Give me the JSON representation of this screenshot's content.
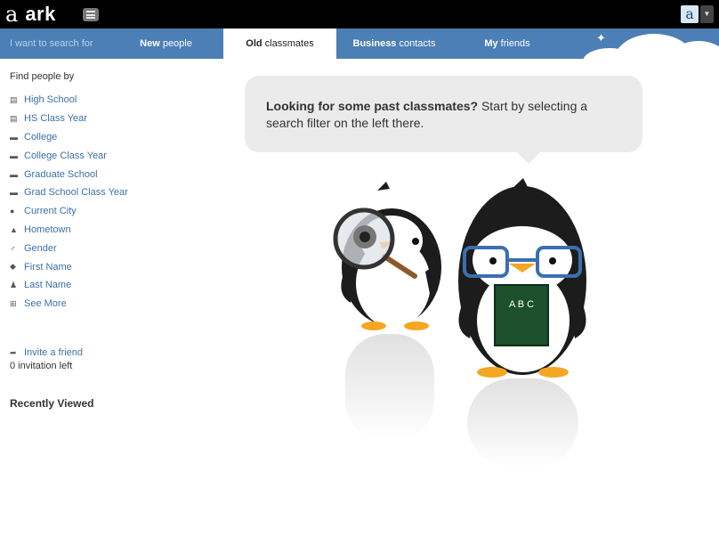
{
  "app": {
    "logo_mark": "a",
    "logo_text": "ark",
    "account_initial": "a",
    "account_caret": "▼"
  },
  "nav": {
    "search_prompt": "I want to search for",
    "tabs": [
      {
        "bold": "New",
        "rest": " people",
        "active": false
      },
      {
        "bold": "Old",
        "rest": " classmates",
        "active": true
      },
      {
        "bold": "Business",
        "rest": " contacts",
        "active": false
      },
      {
        "bold": "My",
        "rest": " friends",
        "active": false
      }
    ]
  },
  "sidebar": {
    "find_title": "Find people by",
    "filters": [
      {
        "icon": "school-icon",
        "glyph": "▤",
        "label": "High School"
      },
      {
        "icon": "school-icon",
        "glyph": "▤",
        "label": "HS Class Year"
      },
      {
        "icon": "graduation-cap-icon",
        "glyph": "▬",
        "label": "College"
      },
      {
        "icon": "graduation-cap-icon",
        "glyph": "▬",
        "label": "College Class Year"
      },
      {
        "icon": "graduation-cap-icon",
        "glyph": "▬",
        "label": "Graduate School"
      },
      {
        "icon": "graduation-cap-icon",
        "glyph": "▬",
        "label": "Grad School Class Year"
      },
      {
        "icon": "location-pin-icon",
        "glyph": "●",
        "label": "Current City"
      },
      {
        "icon": "home-icon",
        "glyph": "▲",
        "label": "Hometown"
      },
      {
        "icon": "gender-icon",
        "glyph": "♂",
        "label": "Gender"
      },
      {
        "icon": "tag-icon",
        "glyph": "◆",
        "label": "First Name"
      },
      {
        "icon": "person-icon",
        "glyph": "♟",
        "label": "Last Name"
      },
      {
        "icon": "plus-box-icon",
        "glyph": "⊞",
        "label": "See More"
      }
    ],
    "invite_label": "Invite a friend",
    "invite_glyph": "➦",
    "invitations_left": "0 invitation left",
    "recent_title": "Recently Viewed"
  },
  "bubble": {
    "bold": "Looking for some past classmates?",
    "rest": " Start by selecting a search filter on the left there."
  },
  "illustration": {
    "book_text": "A B C"
  },
  "colors": {
    "nav_bg": "#4b7fb5",
    "link": "#3b70a8",
    "topbar": "#000000",
    "bubble_bg": "#ebebeb",
    "glasses": "#3b6fb0",
    "book": "#1c4f2c",
    "feet": "#f5a623"
  }
}
